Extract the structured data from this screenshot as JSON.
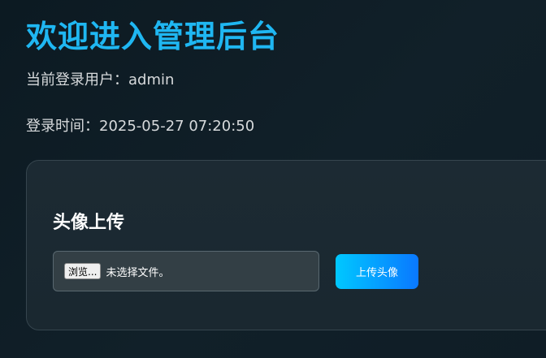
{
  "header": {
    "title": "欢迎进入管理后台"
  },
  "session": {
    "user_label": "当前登录用户：",
    "username": "admin",
    "time_label": "登录时间：",
    "login_time": "2025-05-27 07:20:50"
  },
  "upload": {
    "title": "头像上传",
    "browse_label": "浏览...",
    "file_status": "未选择文件。",
    "submit_label": "上传头像"
  },
  "colors": {
    "background": "#0e1c24",
    "title_accent": "#1fb7f2",
    "button_gradient_start": "#00c8ff",
    "button_gradient_end": "#0a78ff"
  }
}
